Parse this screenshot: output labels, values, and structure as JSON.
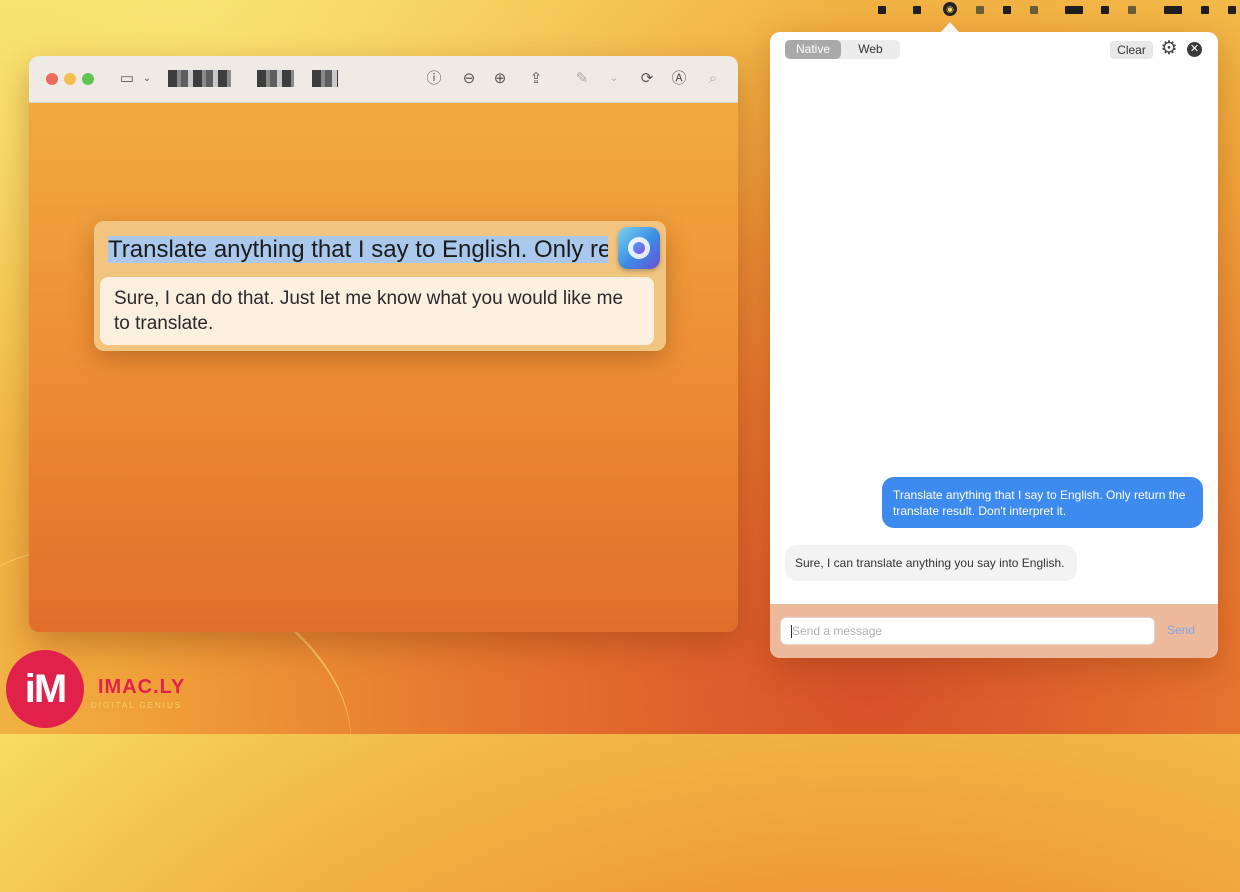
{
  "menubar": {
    "app_icon": "translator-bubble-icon"
  },
  "preview_window": {
    "toolbar_icons": [
      "sidebar-icon",
      "chevron-down-icon",
      "info-icon",
      "zoom-out-icon",
      "zoom-in-icon",
      "share-icon",
      "markup-pen-icon",
      "chevron-down-icon",
      "rotate-icon",
      "annotate-icon",
      "search-icon"
    ]
  },
  "popup": {
    "input_text": "Translate anything that I say to English. Only re",
    "result_text": "Sure, I can do that. Just let me know what you would like me to translate."
  },
  "chat_panel": {
    "mode_tabs": [
      {
        "label": "Native",
        "selected": true
      },
      {
        "label": "Web",
        "selected": false
      }
    ],
    "clear_label": "Clear",
    "messages": [
      {
        "role": "user",
        "text": "Translate anything that I say to English. Only return the translate result. Don't interpret it."
      },
      {
        "role": "assistant",
        "text": "Sure, I can translate anything you say into English."
      }
    ],
    "input_placeholder": "Send a message",
    "send_label": "Send",
    "accent_color": "#3e8bf0"
  },
  "watermark": {
    "logo_text": "iM",
    "brand": "IMAC.LY",
    "tagline": "DIGITAL GENIUS"
  }
}
